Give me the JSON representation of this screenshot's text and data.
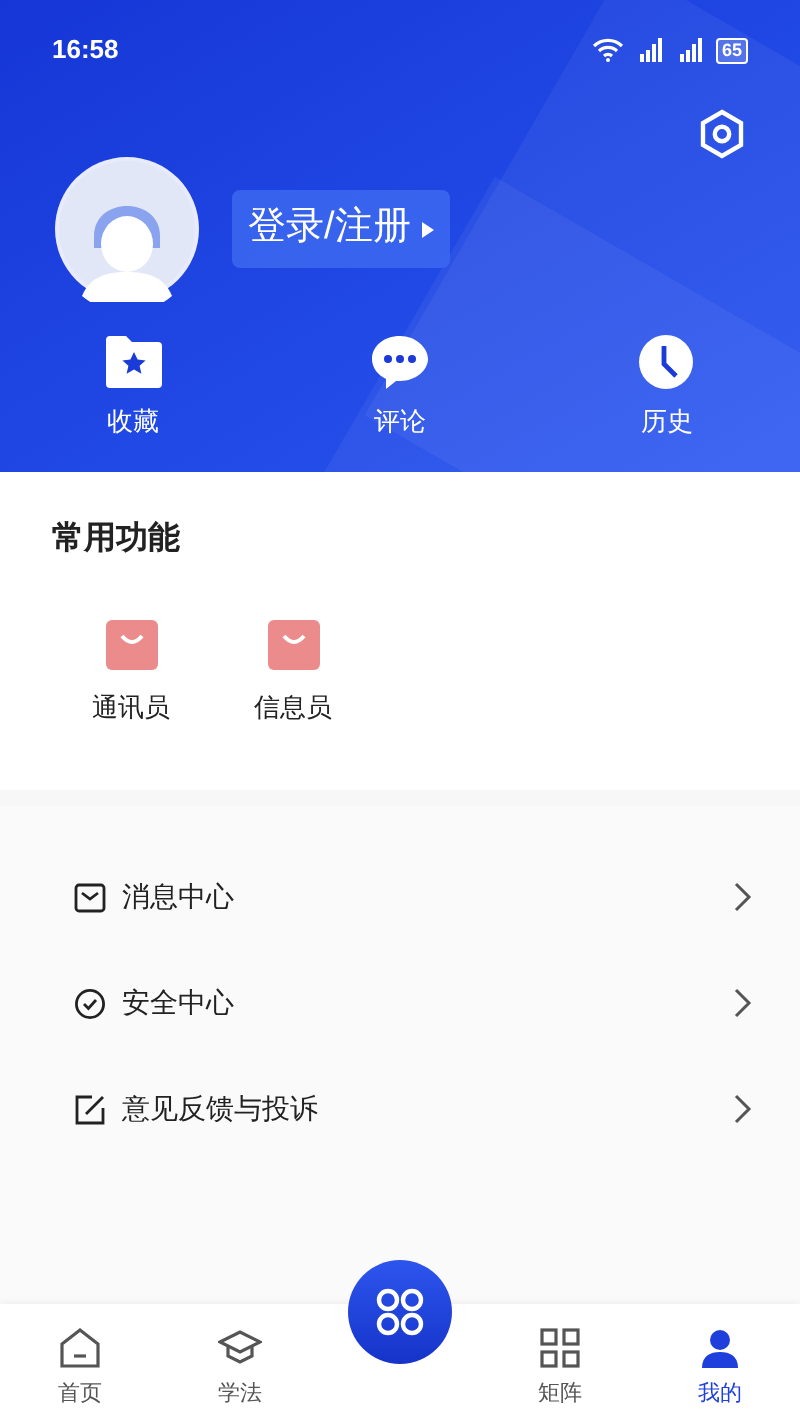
{
  "status_bar": {
    "time": "16:58",
    "battery": "65"
  },
  "header": {
    "login_label": "登录/注册",
    "shortcuts": [
      {
        "kind": "favorite",
        "label": "收藏"
      },
      {
        "kind": "comment",
        "label": "评论"
      },
      {
        "kind": "history",
        "label": "历史"
      }
    ]
  },
  "common_functions": {
    "title": "常用功能",
    "items": [
      {
        "label": "通讯员"
      },
      {
        "label": "信息员"
      }
    ]
  },
  "menu": [
    {
      "kind": "message",
      "label": "消息中心"
    },
    {
      "kind": "security",
      "label": "安全中心"
    },
    {
      "kind": "feedback",
      "label": "意见反馈与投诉"
    }
  ],
  "bottom_nav": [
    {
      "kind": "home",
      "label": "首页",
      "selected": false
    },
    {
      "kind": "study",
      "label": "学法",
      "selected": false
    },
    {
      "kind": "center"
    },
    {
      "kind": "matrix",
      "label": "矩阵",
      "selected": false
    },
    {
      "kind": "me",
      "label": "我的",
      "selected": true
    }
  ]
}
